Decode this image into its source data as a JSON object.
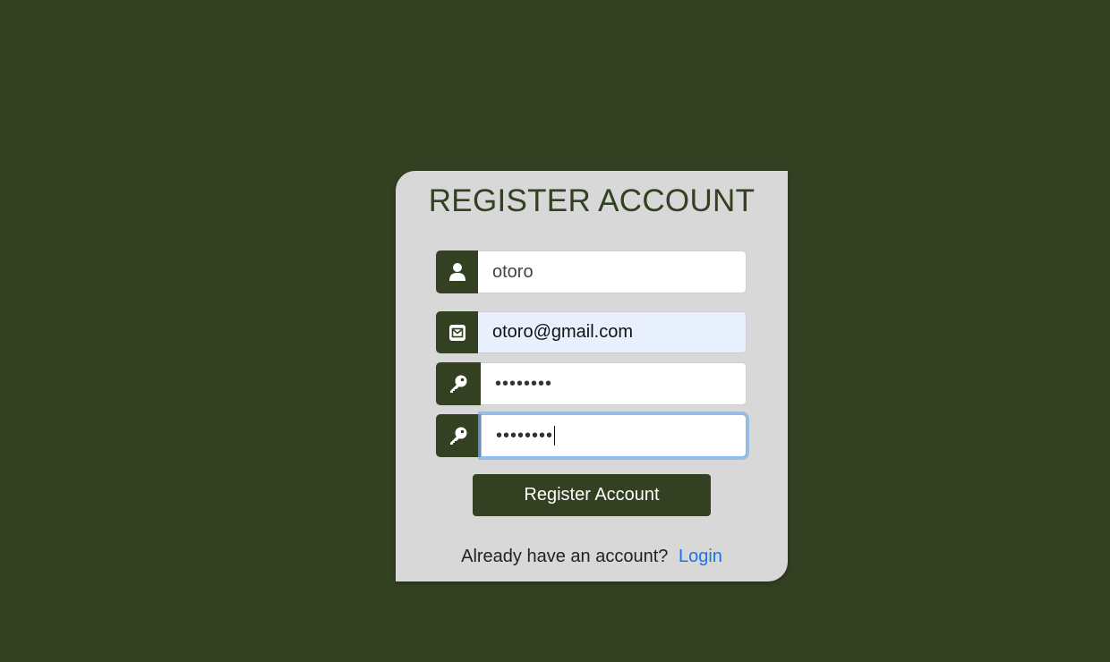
{
  "title": "REGISTER ACCOUNT",
  "fields": {
    "username": {
      "value": "otoro",
      "icon": "user-icon"
    },
    "email": {
      "value": "otoro@gmail.com",
      "icon": "envelope-icon"
    },
    "password": {
      "value": "••••••••",
      "icon": "key-icon"
    },
    "confirm_password": {
      "value": "••••••••",
      "icon": "key-icon"
    }
  },
  "button": {
    "label": "Register Account"
  },
  "footer": {
    "text": "Already have an account?",
    "link": "Login"
  },
  "colors": {
    "background": "#334021",
    "card": "#d8d8d8",
    "accent": "#334021",
    "link": "#1a73e8",
    "autofill": "#e8f0fe"
  }
}
